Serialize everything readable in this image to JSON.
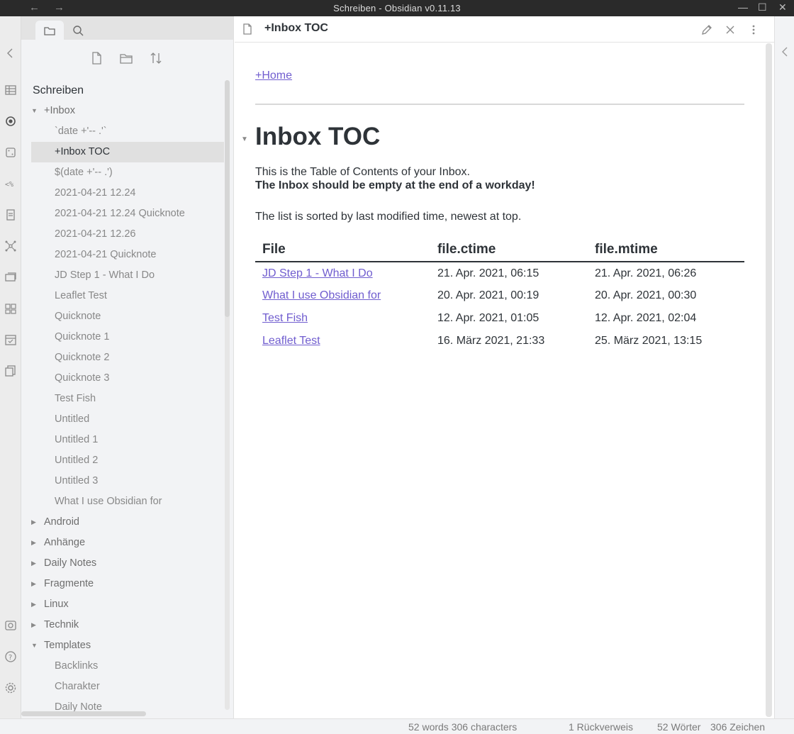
{
  "window": {
    "title": "Schreiben - Obsidian v0.11.13",
    "back_glyph": "←",
    "forward_glyph": "→",
    "minimize_glyph": "—",
    "maximize_glyph": "☐",
    "close_glyph": "✕"
  },
  "sidebar": {
    "vault_name": "Schreiben",
    "tabs": [
      {
        "icon": "folder-icon",
        "active": true
      },
      {
        "icon": "search-icon",
        "active": false
      }
    ],
    "actions": [
      "new-note-icon",
      "new-folder-icon",
      "sort-icon"
    ],
    "tree": [
      {
        "label": "+Inbox",
        "type": "folder",
        "expanded": true
      },
      {
        "label": "`date +'-- .'`",
        "type": "file"
      },
      {
        "label": "+Inbox TOC",
        "type": "file",
        "active": true
      },
      {
        "label": "$(date +'-- .')",
        "type": "file"
      },
      {
        "label": "2021-04-21 12.24",
        "type": "file"
      },
      {
        "label": "2021-04-21 12.24 Quicknote",
        "type": "file"
      },
      {
        "label": "2021-04-21 12.26",
        "type": "file"
      },
      {
        "label": "2021-04-21 Quicknote",
        "type": "file"
      },
      {
        "label": "JD Step 1 - What I Do",
        "type": "file"
      },
      {
        "label": "Leaflet Test",
        "type": "file"
      },
      {
        "label": "Quicknote",
        "type": "file"
      },
      {
        "label": "Quicknote 1",
        "type": "file"
      },
      {
        "label": "Quicknote 2",
        "type": "file"
      },
      {
        "label": "Quicknote 3",
        "type": "file"
      },
      {
        "label": "Test Fish",
        "type": "file"
      },
      {
        "label": "Untitled",
        "type": "file"
      },
      {
        "label": "Untitled 1",
        "type": "file"
      },
      {
        "label": "Untitled 2",
        "type": "file"
      },
      {
        "label": "Untitled 3",
        "type": "file"
      },
      {
        "label": "What I use Obsidian for",
        "type": "file"
      },
      {
        "label": "Android",
        "type": "folder",
        "expanded": false
      },
      {
        "label": "Anhänge",
        "type": "folder",
        "expanded": false
      },
      {
        "label": "Daily Notes",
        "type": "folder",
        "expanded": false
      },
      {
        "label": "Fragmente",
        "type": "folder",
        "expanded": false
      },
      {
        "label": "Linux",
        "type": "folder",
        "expanded": false
      },
      {
        "label": "Technik",
        "type": "folder",
        "expanded": false
      },
      {
        "label": "Templates",
        "type": "folder",
        "expanded": true
      },
      {
        "label": "Backlinks",
        "type": "file"
      },
      {
        "label": "Charakter",
        "type": "file"
      },
      {
        "label": "Daily Note",
        "type": "file"
      }
    ]
  },
  "tab": {
    "title": "+Inbox TOC"
  },
  "note": {
    "home_link": "+Home",
    "heading": "Inbox TOC",
    "intro": "This is the Table of Contents of your Inbox.",
    "intro_bold": "The Inbox should be empty at the end of a workday!",
    "sorted_note": "The list is sorted by last modified time, newest at top.",
    "table": {
      "headers": [
        "File",
        "file.ctime",
        "file.mtime"
      ],
      "rows": [
        [
          "JD Step 1 - What I Do",
          "21. Apr. 2021, 06:15",
          "21. Apr. 2021, 06:26"
        ],
        [
          "What I use Obsidian for",
          "20. Apr. 2021, 00:19",
          "20. Apr. 2021, 00:30"
        ],
        [
          "Test Fish",
          "12. Apr. 2021, 01:05",
          "12. Apr. 2021, 02:04"
        ],
        [
          "Leaflet Test",
          "16. März 2021, 21:33",
          "25. März 2021, 13:15"
        ]
      ]
    }
  },
  "statusbar": {
    "words_chars": "52 words 306 characters",
    "backlinks": "1 Rückverweis",
    "woerter": "52 Wörter",
    "zeichen": "306 Zeichen"
  },
  "colors": {
    "link": "#705dcf",
    "sidebar_bg": "#f2f3f5",
    "titlebar_bg": "#2a2a2a"
  }
}
